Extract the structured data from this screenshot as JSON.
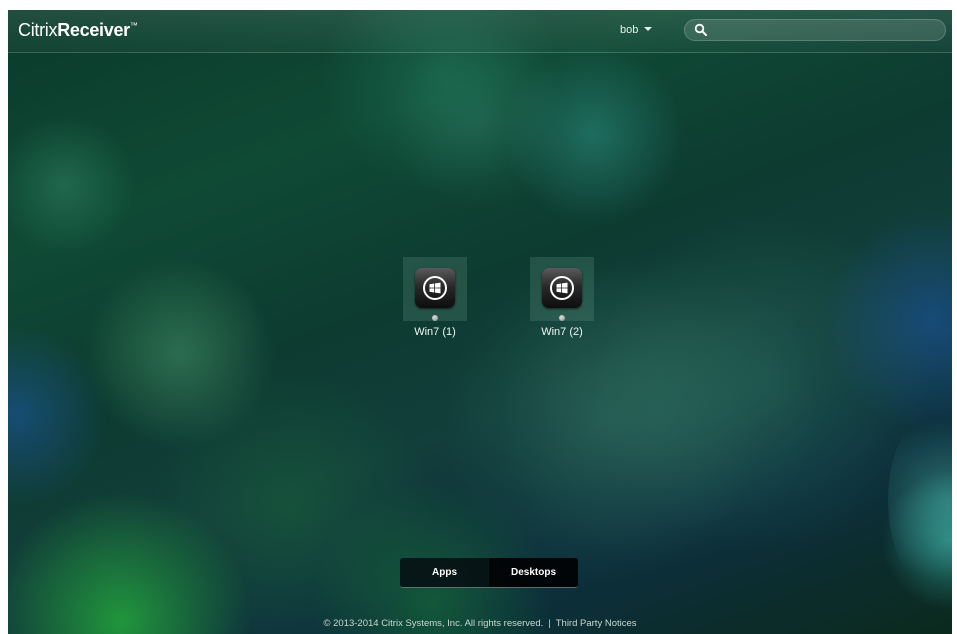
{
  "header": {
    "logo_prefix": "Citrix",
    "logo_product": "Receiver",
    "logo_tm": "™",
    "user_name": "bob",
    "search": {
      "value": "",
      "placeholder": ""
    }
  },
  "desktops": [
    {
      "label": "Win7 (1)",
      "icon": "windows-logo-icon",
      "status": "available"
    },
    {
      "label": "Win7 (2)",
      "icon": "windows-logo-icon",
      "status": "available"
    }
  ],
  "tabs": {
    "apps": "Apps",
    "desktops": "Desktops",
    "active": "desktops"
  },
  "footer": {
    "copyright": "© 2013-2014 Citrix Systems, Inc. All rights reserved.",
    "separator": "|",
    "third_party": "Third Party Notices"
  },
  "colors": {
    "text": "#ffffff",
    "tab_active_bg": "#000000",
    "tile_bg": "#78aa96"
  }
}
